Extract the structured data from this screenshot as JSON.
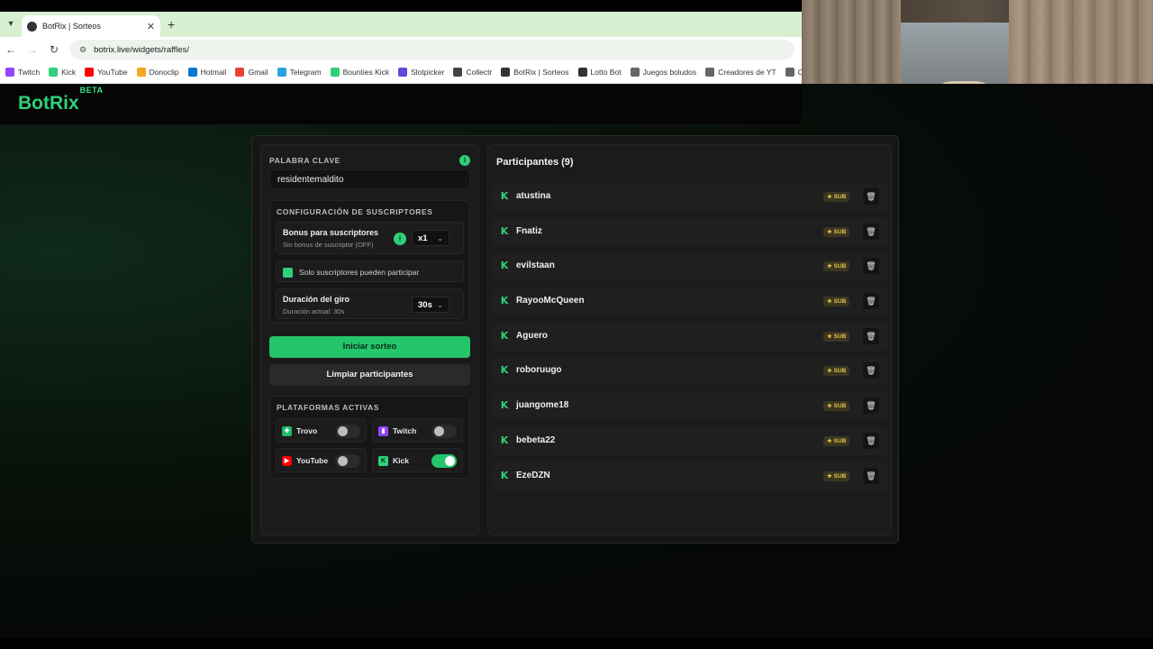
{
  "browser": {
    "tab_title": "BotRix | Sorteos",
    "url": "botrix.live/widgets/raffles/",
    "bookmarks": [
      {
        "label": "Twitch",
        "color": "#9146ff"
      },
      {
        "label": "Kick",
        "color": "#2fd07a"
      },
      {
        "label": "YouTube",
        "color": "#ff0000"
      },
      {
        "label": "Donoclip",
        "color": "#f5a623"
      },
      {
        "label": "Hotmail",
        "color": "#0078d4"
      },
      {
        "label": "Gmail",
        "color": "#ea4335"
      },
      {
        "label": "Telegram",
        "color": "#2aa3e0"
      },
      {
        "label": "Bounties Kick",
        "color": "#2fd07a"
      },
      {
        "label": "Slotpicker",
        "color": "#5b4bd6"
      },
      {
        "label": "Collectr",
        "color": "#444444"
      },
      {
        "label": "BotRix | Sorteos",
        "color": "#333333"
      },
      {
        "label": "Lotto Bot",
        "color": "#333333"
      },
      {
        "label": "Juegos boludos",
        "color": "#666666"
      },
      {
        "label": "Creadores de YT",
        "color": "#666666"
      },
      {
        "label": "Cas",
        "color": "#666666"
      }
    ]
  },
  "app": {
    "logo": "BotRix",
    "logo_badge": "BETA",
    "accent": "#24c56b"
  },
  "left": {
    "keyword_label": "PALABRA CLAVE",
    "keyword_value": "residentemaldito",
    "subs_header": "CONFIGURACIÓN DE SUSCRIPTORES",
    "bonus_title": "Bonus para suscriptores",
    "bonus_sub": "Sin bonus de suscriptor (OFF)",
    "bonus_value": "x1",
    "subs_only_label": "Solo suscriptores pueden participar",
    "duration_title": "Duración del giro",
    "duration_sub": "Duración actual: 30s",
    "duration_value": "30s",
    "start_button": "Iniciar sorteo",
    "clear_button": "Limpiar participantes",
    "platforms_header": "PLATAFORMAS ACTIVAS",
    "platforms": {
      "trovo": {
        "label": "Trovo",
        "on": false
      },
      "twitch": {
        "label": "Twitch",
        "on": false
      },
      "youtube": {
        "label": "YouTube",
        "on": false
      },
      "kick": {
        "label": "Kick",
        "on": true
      }
    }
  },
  "participants": {
    "title": "Participantes (9)",
    "badge": "SUB",
    "list": [
      "atustina",
      "Fnatiz",
      "evilstaan",
      "RayooMcQueen",
      "Aguero",
      "roboruugo",
      "juangome18",
      "bebeta22",
      "EzeDZN"
    ]
  }
}
